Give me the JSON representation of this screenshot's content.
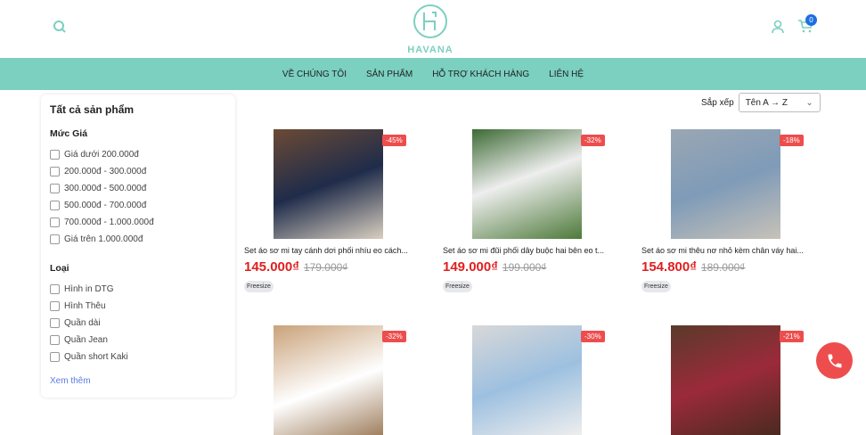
{
  "header": {
    "brand": "HAVANA",
    "cart_count": "0"
  },
  "nav": [
    "VỀ CHÚNG TÔI",
    "SẢN PHẨM",
    "HỖ TRỢ KHÁCH HÀNG",
    "LIÊN HỆ"
  ],
  "sidebar": {
    "title": "Tất cả sản phẩm",
    "price_heading": "Mức Giá",
    "price_options": [
      "Giá dưới 200.000đ",
      "200.000đ - 300.000đ",
      "300.000đ - 500.000đ",
      "500.000đ - 700.000đ",
      "700.000đ - 1.000.000đ",
      "Giá trên 1.000.000đ"
    ],
    "type_heading": "Loại",
    "type_options": [
      "Hình in DTG",
      "Hình Thêu",
      "Quần dài",
      "Quần Jean",
      "Quần short Kaki"
    ],
    "more": "Xem thêm"
  },
  "sort": {
    "label": "Sắp xếp",
    "value": "Tên A → Z"
  },
  "products": [
    {
      "discount": "-45%",
      "name": "Set áo sơ mi tay cánh dơi phối nhíu eo cách...",
      "price": "145.000₫",
      "old": "179.000₫",
      "size": "Freesize"
    },
    {
      "discount": "-32%",
      "name": "Set áo sơ mi đũi phối dây buộc hai bên eo t...",
      "price": "149.000₫",
      "old": "199.000₫",
      "size": "Freesize"
    },
    {
      "discount": "-18%",
      "name": "Set áo sơ mi thêu nơ nhỏ kèm chân váy hai...",
      "price": "154.800₫",
      "old": "189.000₫",
      "size": "Freesize"
    },
    {
      "discount": "-32%"
    },
    {
      "discount": "-30%"
    },
    {
      "discount": "-21%"
    }
  ]
}
